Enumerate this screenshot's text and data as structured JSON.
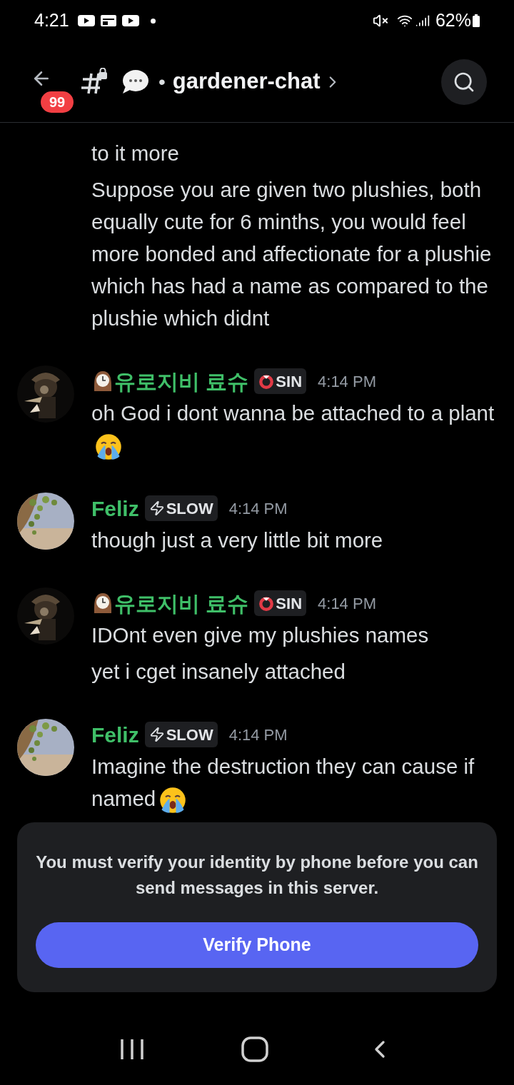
{
  "status_bar": {
    "time": "4:21",
    "battery": "62%"
  },
  "header": {
    "unread_badge": "99",
    "separator": "•",
    "channel": "gardener-chat"
  },
  "groups": [
    {
      "messages": [
        {
          "kind": "text",
          "text": "to it more"
        },
        {
          "kind": "text",
          "text": "Suppose you are given two plushies, both equally cute for 6 minths, you would feel more bonded and affectionate for a plushie which has had a name as compared to the plushie which didnt"
        }
      ]
    },
    {
      "author": {
        "kind": "sinner",
        "name": "유로지비 료슈",
        "tag": "SIN",
        "time": "4:14 PM"
      },
      "messages": [
        {
          "kind": "crying",
          "text": "oh God i dont wanna be attached to a plant"
        }
      ]
    },
    {
      "author": {
        "kind": "gardener",
        "name": "Feliz",
        "tag": "SLOW",
        "time": "4:14 PM"
      },
      "messages": [
        {
          "kind": "text",
          "text": "though just a very little bit more"
        }
      ]
    },
    {
      "author": {
        "kind": "sinner",
        "name": "유로지비 료슈",
        "tag": "SIN",
        "time": "4:14 PM"
      },
      "messages": [
        {
          "kind": "text",
          "text": "IDOnt even give my plushies names"
        },
        {
          "kind": "text",
          "text": "yet i cget insanely attached"
        }
      ]
    },
    {
      "author": {
        "kind": "gardener",
        "name": "Feliz",
        "tag": "SLOW",
        "time": "4:14 PM"
      },
      "messages": [
        {
          "kind": "crying",
          "text": "Imagine the destruction they can cause if named"
        }
      ]
    }
  ],
  "verify": {
    "notice": "You must verify your identity by phone before you can send messages in this server.",
    "button": "Verify Phone"
  }
}
